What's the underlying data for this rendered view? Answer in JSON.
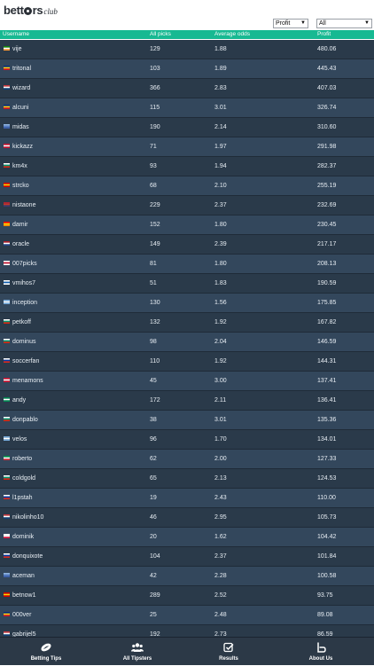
{
  "header": {
    "logo_main_1": "bett",
    "logo_main_2": "rs",
    "logo_sub": "club"
  },
  "filters": {
    "sort": {
      "value": "Profit"
    },
    "scope": {
      "value": "All"
    }
  },
  "table": {
    "columns": [
      "Username",
      "All picks",
      "Average odds",
      "Profit"
    ],
    "rows": [
      {
        "username": "vije",
        "picks": "129",
        "odds": "1.88",
        "profit": "480.06",
        "flag": [
          "#138808",
          "#ffffff",
          "#ff9933"
        ]
      },
      {
        "username": "tritonal",
        "picks": "103",
        "odds": "1.89",
        "profit": "445.43",
        "flag": [
          "#002b7f",
          "#fcd116",
          "#ce1126"
        ]
      },
      {
        "username": "wizard",
        "picks": "366",
        "odds": "2.83",
        "profit": "407.03",
        "flag": [
          "#c6363c",
          "#ffffff",
          "#0c4076"
        ]
      },
      {
        "username": "alcuni",
        "picks": "115",
        "odds": "3.01",
        "profit": "326.74",
        "flag": [
          "#002b7f",
          "#fcd116",
          "#ce1126"
        ]
      },
      {
        "username": "midas",
        "picks": "190",
        "odds": "2.14",
        "profit": "310.60",
        "flag": [
          "#8fb4e0",
          "#5a82c7",
          "#3b5fa8"
        ]
      },
      {
        "username": "kickazz",
        "picks": "71",
        "odds": "1.97",
        "profit": "291.98",
        "flag": [
          "#c8102e",
          "#ffffff",
          "#c8102e"
        ]
      },
      {
        "username": "km4x",
        "picks": "93",
        "odds": "1.94",
        "profit": "282.37",
        "flag": [
          "#ffffff",
          "#00966e",
          "#d62612"
        ]
      },
      {
        "username": "strcko",
        "picks": "68",
        "odds": "2.10",
        "profit": "255.19",
        "flag": [
          "#d20000",
          "#ffd700",
          "#d20000"
        ]
      },
      {
        "username": "nistaone",
        "picks": "229",
        "odds": "2.37",
        "profit": "232.69",
        "flag": [
          "#b22234",
          "#c0392b",
          "#3c3b6e"
        ]
      },
      {
        "username": "damir",
        "picks": "152",
        "odds": "1.80",
        "profit": "230.45",
        "flag": [
          "#ff0000",
          "#ffd700",
          "#ff8c00"
        ]
      },
      {
        "username": "oracle",
        "picks": "149",
        "odds": "2.39",
        "profit": "217.17",
        "flag": [
          "#ae1c28",
          "#ffffff",
          "#21468b"
        ]
      },
      {
        "username": "007picks",
        "picks": "81",
        "odds": "1.80",
        "profit": "208.13",
        "flag": [
          "#ffffff",
          "#c8102e",
          "#ffffff"
        ]
      },
      {
        "username": "vmihos7",
        "picks": "51",
        "odds": "1.83",
        "profit": "190.59",
        "flag": [
          "#ffffff",
          "#0d5eaf",
          "#ffffff"
        ]
      },
      {
        "username": "inception",
        "picks": "130",
        "odds": "1.56",
        "profit": "175.85",
        "flag": [
          "#75aadb",
          "#ffffff",
          "#75aadb"
        ]
      },
      {
        "username": "petkoff",
        "picks": "132",
        "odds": "1.92",
        "profit": "167.82",
        "flag": [
          "#ffffff",
          "#00966e",
          "#d62612"
        ]
      },
      {
        "username": "dominus",
        "picks": "98",
        "odds": "2.04",
        "profit": "146.59",
        "flag": [
          "#ffffff",
          "#00966e",
          "#d62612"
        ]
      },
      {
        "username": "soccerfan",
        "picks": "110",
        "odds": "1.92",
        "profit": "144.31",
        "flag": [
          "#ffffff",
          "#0039a6",
          "#d52b1e"
        ]
      },
      {
        "username": "menamons",
        "picks": "45",
        "odds": "3.00",
        "profit": "137.41",
        "flag": [
          "#c8102e",
          "#ffffff",
          "#c8102e"
        ]
      },
      {
        "username": "andy",
        "picks": "172",
        "odds": "2.11",
        "profit": "136.41",
        "flag": [
          "#008751",
          "#ffffff",
          "#008751"
        ]
      },
      {
        "username": "donpablo",
        "picks": "38",
        "odds": "3.01",
        "profit": "135.36",
        "flag": [
          "#ffffff",
          "#00966e",
          "#d62612"
        ]
      },
      {
        "username": "velos",
        "picks": "96",
        "odds": "1.70",
        "profit": "134.01",
        "flag": [
          "#75aadb",
          "#ffffff",
          "#75aadb"
        ]
      },
      {
        "username": "roberto",
        "picks": "62",
        "odds": "2.00",
        "profit": "127.33",
        "flag": [
          "#009246",
          "#ffffff",
          "#ce2b37"
        ]
      },
      {
        "username": "coldgold",
        "picks": "65",
        "odds": "2.13",
        "profit": "124.53",
        "flag": [
          "#ffffff",
          "#00966e",
          "#d62612"
        ]
      },
      {
        "username": "l1pstah",
        "picks": "19",
        "odds": "2.43",
        "profit": "110.00",
        "flag": [
          "#ffffff",
          "#0039a6",
          "#d52b1e"
        ]
      },
      {
        "username": "nikolinho10",
        "picks": "46",
        "odds": "2.95",
        "profit": "105.73",
        "flag": [
          "#c6363c",
          "#ffffff",
          "#0c4076"
        ]
      },
      {
        "username": "dominik",
        "picks": "20",
        "odds": "1.62",
        "profit": "104.42",
        "flag": [
          "#ffffff",
          "#ffffff",
          "#dc143c"
        ]
      },
      {
        "username": "donquixote",
        "picks": "104",
        "odds": "2.37",
        "profit": "101.84",
        "flag": [
          "#ffffff",
          "#0039a6",
          "#d52b1e"
        ]
      },
      {
        "username": "aceman",
        "picks": "42",
        "odds": "2.28",
        "profit": "100.58",
        "flag": [
          "#8fb4e0",
          "#5a82c7",
          "#3b5fa8"
        ]
      },
      {
        "username": "betnow1",
        "picks": "289",
        "odds": "2.52",
        "profit": "93.75",
        "flag": [
          "#d20000",
          "#ffd700",
          "#d20000"
        ]
      },
      {
        "username": "000ver",
        "picks": "25",
        "odds": "2.48",
        "profit": "89.08",
        "flag": [
          "#002b7f",
          "#fcd116",
          "#ce1126"
        ]
      },
      {
        "username": "gabrijel5",
        "picks": "192",
        "odds": "2.73",
        "profit": "86.59",
        "flag": [
          "#c6363c",
          "#ffffff",
          "#0c4076"
        ]
      }
    ]
  },
  "tabbar": {
    "tips": {
      "label": "Betting Tips",
      "icon": "football-icon"
    },
    "tipsters": {
      "label": "All Tipsters",
      "icon": "users-icon"
    },
    "results": {
      "label": "Results",
      "icon": "checkbox-icon"
    },
    "about": {
      "label": "About Us",
      "icon": "bettors-b-icon"
    }
  },
  "colors": {
    "header_accent": "#17b992",
    "row_dark": "#2a3a4a",
    "row_light": "#33475c",
    "tabbar_bg": "#2c3947"
  }
}
